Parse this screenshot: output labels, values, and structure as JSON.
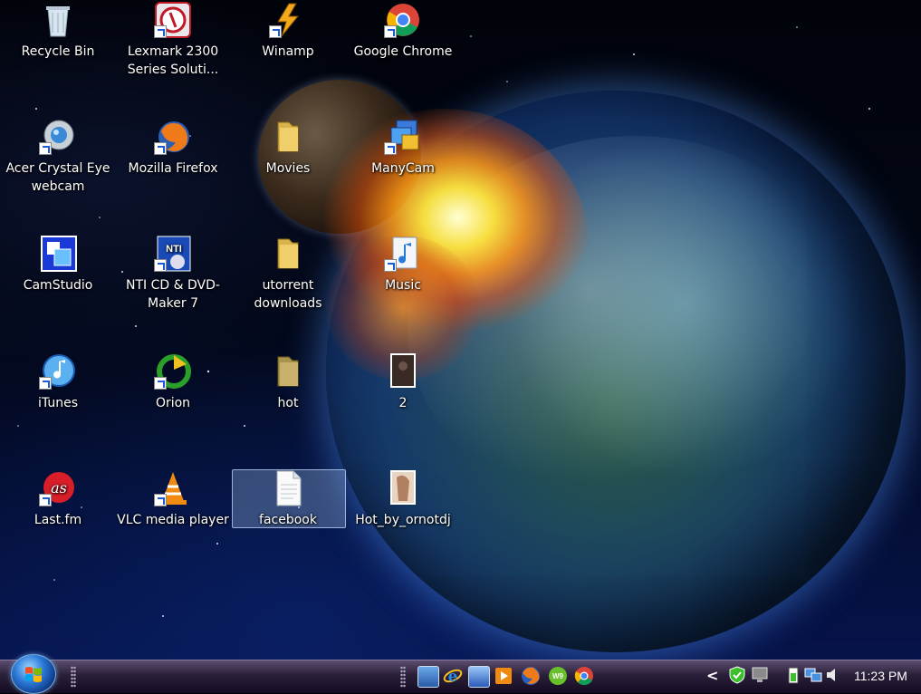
{
  "desktop": {
    "icons": [
      {
        "label": "Recycle Bin",
        "icon": "recycle-bin-icon"
      },
      {
        "label": "Lexmark 2300 Series Soluti...",
        "icon": "lexmark-icon"
      },
      {
        "label": "Winamp",
        "icon": "winamp-icon"
      },
      {
        "label": "Google Chrome",
        "icon": "chrome-icon"
      },
      {
        "label": "Acer Crystal Eye webcam",
        "icon": "webcam-icon"
      },
      {
        "label": "Mozilla Firefox",
        "icon": "firefox-icon"
      },
      {
        "label": "Movies",
        "icon": "folder-icon"
      },
      {
        "label": "ManyCam",
        "icon": "manycam-icon"
      },
      {
        "label": "CamStudio",
        "icon": "camstudio-icon"
      },
      {
        "label": "NTI CD & DVD-Maker 7",
        "icon": "nti-icon"
      },
      {
        "label": "utorrent downloads",
        "icon": "folder-icon"
      },
      {
        "label": "Music",
        "icon": "music-shortcut-icon"
      },
      {
        "label": "iTunes",
        "icon": "itunes-icon"
      },
      {
        "label": "Orion",
        "icon": "orion-icon"
      },
      {
        "label": "hot",
        "icon": "folder-icon"
      },
      {
        "label": "2",
        "icon": "image-thumbnail-icon"
      },
      {
        "label": "Last.fm",
        "icon": "lastfm-icon"
      },
      {
        "label": "VLC media player",
        "icon": "vlc-icon"
      },
      {
        "label": "facebook",
        "icon": "text-file-icon",
        "selected": true
      },
      {
        "label": "Hot_by_ornotdj",
        "icon": "image-thumbnail-icon"
      }
    ]
  },
  "taskbar": {
    "start_button": "start-orb-icon",
    "quick_launch": [
      "show-desktop-icon",
      "internet-explorer-icon",
      "switch-windows-icon",
      "media-player-icon",
      "firefox-icon",
      "w-2009-icon",
      "chrome-icon"
    ],
    "tray": {
      "chevron": "<",
      "icons": [
        "green-shield-icon",
        "monitor-icon",
        "battery-icon",
        "network-icon",
        "volume-icon"
      ],
      "clock": "11:23 PM"
    }
  },
  "colors": {
    "taskbar_top": "#5a4d6e",
    "taskbar_bottom": "#140c22",
    "selection": "#96b4dc",
    "text": "#ffffff"
  }
}
